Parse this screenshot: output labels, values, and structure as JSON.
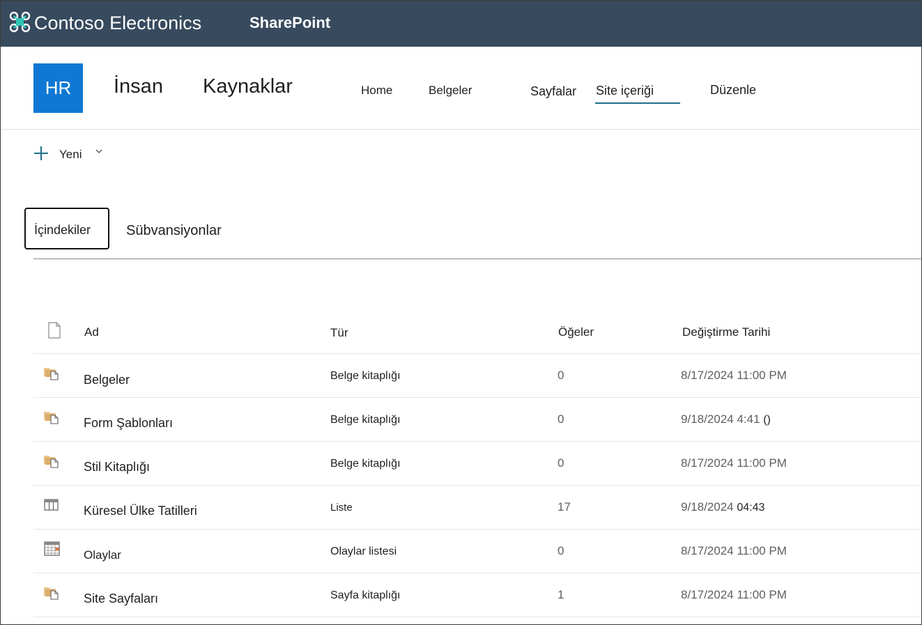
{
  "suite_bar": {
    "org_name": "Contoso Electronics",
    "app_name": "SharePoint",
    "logo_icon": "contoso-logo-icon",
    "background": "#374a5e"
  },
  "site": {
    "logo_text": "HR",
    "logo_color": "#0f78d4",
    "title_part1": "İnsan",
    "title_part2": "Kaynaklar"
  },
  "nav": {
    "home": "Home",
    "belgeler": "Belgeler",
    "sayfalar": "Sayfalar",
    "site_icerigi": "Site içeriği",
    "duzenle": "Düzenle",
    "active": "Site içeriği",
    "accent": "#1e6f86"
  },
  "command_bar": {
    "new_label": "Yeni",
    "new_icon": "plus-icon",
    "dropdown_icon": "chevron-down-icon"
  },
  "tabs": [
    {
      "label": "İçindekiler",
      "selected": true
    },
    {
      "label": "Sübvansiyonlar",
      "selected": false
    }
  ],
  "table": {
    "headers": {
      "icon": "file-icon",
      "name": "Ad",
      "type": "Tür",
      "items": "Öğeler",
      "modified": "Değiştirme Tarihi"
    },
    "rows": [
      {
        "icon": "document-library-icon",
        "name": "Belgeler",
        "type": "Belge kitaplığı",
        "items": "0",
        "modified": "8/17/2024 11:00 PM",
        "modified_suffix": ""
      },
      {
        "icon": "document-library-icon",
        "name": "Form Şablonları",
        "type": "Belge kitaplığı",
        "items": "0",
        "modified": "9/18/2024 4:41",
        "modified_suffix": "()"
      },
      {
        "icon": "document-library-icon",
        "name": "Stil Kitaplığı",
        "type": "Belge kitaplığı",
        "items": "0",
        "modified": "8/17/2024 11:00 PM",
        "modified_suffix": ""
      },
      {
        "icon": "list-icon",
        "name": "Küresel Ülke Tatilleri",
        "type": "Liste",
        "items": "17",
        "modified": "9/18/2024",
        "modified_suffix": "04:43"
      },
      {
        "icon": "calendar-icon",
        "name": "Olaylar",
        "type": "Olaylar listesi",
        "items": "0",
        "modified": "8/17/2024 11:00 PM",
        "modified_suffix": ""
      },
      {
        "icon": "document-library-icon",
        "name": "Site Sayfaları",
        "type": "Sayfa kitaplığı",
        "items": "1",
        "modified": "8/17/2024 11:00 PM",
        "modified_suffix": ""
      }
    ]
  }
}
